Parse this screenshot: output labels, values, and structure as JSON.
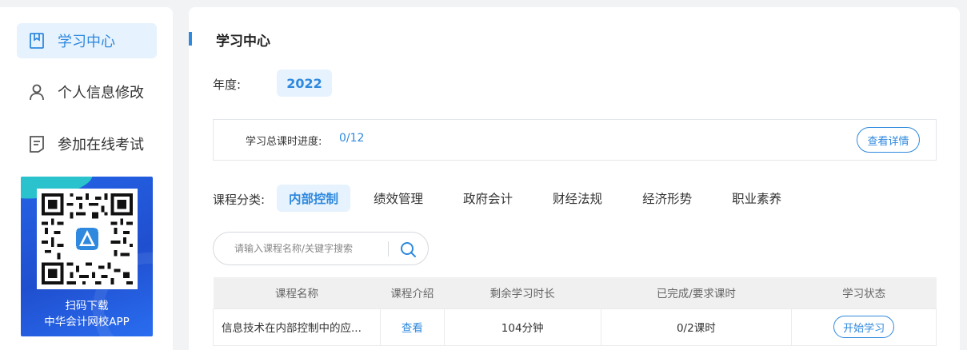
{
  "sidebar": {
    "items": [
      {
        "label": "学习中心",
        "icon": "bookmark-icon",
        "active": true
      },
      {
        "label": "个人信息修改",
        "icon": "user-icon",
        "active": false
      },
      {
        "label": "参加在线考试",
        "icon": "document-icon",
        "active": false
      }
    ],
    "promo": {
      "line1": "扫码下载",
      "line2": "中华会计网校APP"
    }
  },
  "main": {
    "title": "学习中心",
    "year_label": "年度:",
    "year_value": "2022",
    "progress": {
      "label": "学习总课时进度:",
      "value": "0/12",
      "detail_button": "查看详情"
    },
    "category": {
      "label": "课程分类:",
      "tabs": [
        "内部控制",
        "绩效管理",
        "政府会计",
        "财经法规",
        "经济形势",
        "职业素养"
      ],
      "active_index": 0
    },
    "search": {
      "placeholder": "请输入课程名称/关键字搜索"
    },
    "table": {
      "headers": [
        "课程名称",
        "课程介绍",
        "剩余学习时长",
        "已完成/要求课时",
        "学习状态"
      ],
      "rows": [
        {
          "name": "信息技术在内部控制中的应...",
          "intro": "查看",
          "remaining": "104分钟",
          "completed": "0/2课时",
          "status": "开始学习"
        }
      ]
    }
  },
  "colors": {
    "accent": "#2f89de",
    "accent_bg": "#e6f2fd",
    "promo_bg": "#2563e6"
  }
}
